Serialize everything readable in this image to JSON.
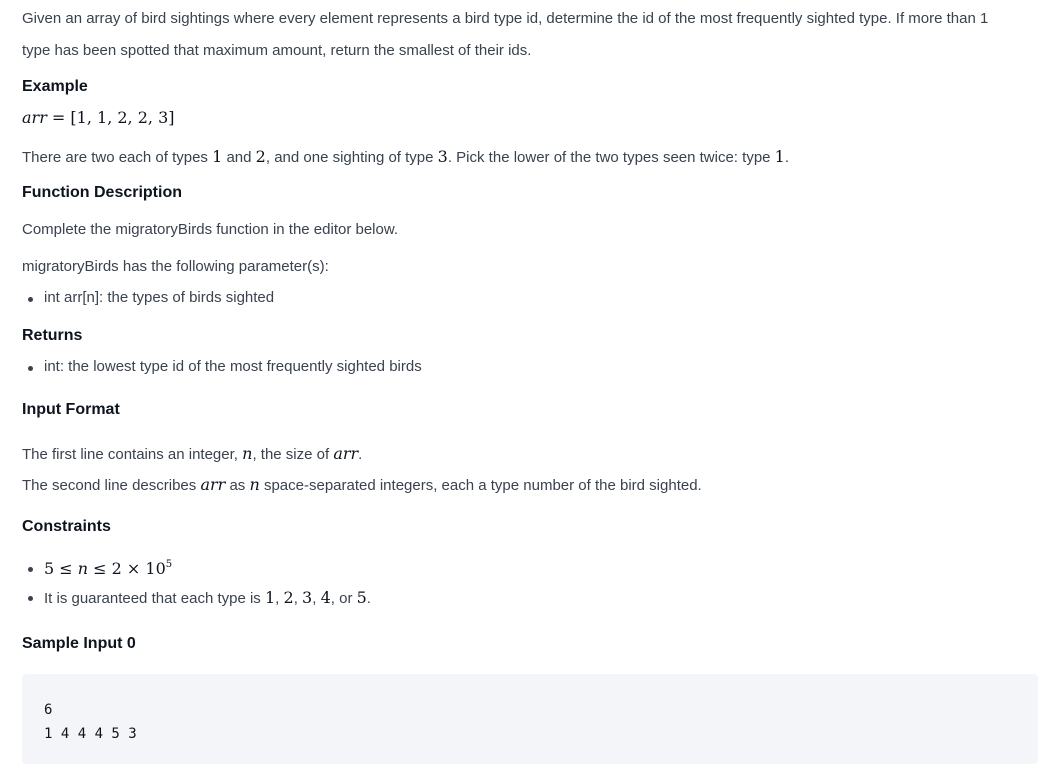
{
  "intro": {
    "line1": "Given an array of bird sightings where every element represents a bird type id, determine the id of the most frequently sighted type. If more than 1",
    "line2": "type has been spotted that maximum amount, return the smallest of their ids."
  },
  "example": {
    "heading": "Example",
    "var": "arr",
    "eq": " = ",
    "value": "[1, 1, 2, 2, 3]",
    "explanation_parts": [
      "There are two each of types ",
      "1",
      " and ",
      "2",
      ", and one sighting of type ",
      "3",
      ". Pick the lower of the two types seen twice: type ",
      "1",
      "."
    ]
  },
  "function_description": {
    "heading": "Function Description",
    "line1": "Complete the migratoryBirds function in the editor below.",
    "line2": "migratoryBirds has the following parameter(s):",
    "params": [
      "int arr[n]: the types of birds sighted"
    ]
  },
  "returns": {
    "heading": "Returns",
    "items": [
      "int: the lowest type id of the most frequently sighted birds"
    ]
  },
  "input_format": {
    "heading": "Input Format",
    "line1_parts": [
      "The first line contains an integer, ",
      "n",
      ", the size of ",
      "arr",
      "."
    ],
    "line2_parts": [
      "The second line describes ",
      "arr",
      " as ",
      "n",
      " space-separated integers, each a type number of the bird sighted."
    ]
  },
  "constraints": {
    "heading": "Constraints",
    "c1": {
      "lhs": "5",
      "op1": " ≤ ",
      "var": "n",
      "op2": " ≤ ",
      "rhs": "2 × 10",
      "exp": "5"
    },
    "c2_parts": [
      "It is guaranteed that each type is ",
      "1",
      ", ",
      "2",
      ", ",
      "3",
      ", ",
      "4",
      ", or ",
      "5",
      "."
    ]
  },
  "sample_input": {
    "heading": "Sample Input 0",
    "lines": [
      "6",
      "1 4 4 4 5 3"
    ]
  }
}
